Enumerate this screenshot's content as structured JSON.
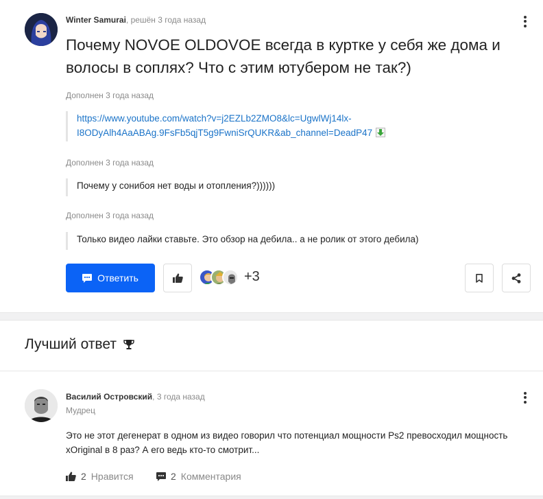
{
  "question": {
    "author": "Winter Samurai",
    "meta_suffix": ", решён 3 года назад",
    "title": "Почему NOVOE OLDOVOE всегда в куртке у себя же дома и волосы в соплях? Что с этим ютубером не так?)",
    "supplements": [
      {
        "label": "Дополнен 3 года назад",
        "link": "https://www.youtube.com/watch?v=j2EZLb2ZMO8&lc=UgwlWj14lx-I8ODyAlh4AaABAg.9FsFb5qjT5g9FwniSrQUKR&ab_channel=DeadP47"
      },
      {
        "label": "Дополнен 3 года назад",
        "text": "Почему у сонибоя нет воды и отопления?))))))"
      },
      {
        "label": "Дополнен 3 года назад",
        "text": "Только видео лайки ставьте. Это обзор на дебила.. а не ролик от этого дебила)"
      }
    ],
    "answer_button": "Ответить",
    "likers_more": "+3",
    "colors": {
      "accent": "#0b63f6",
      "link": "#1a73c8"
    }
  },
  "best_answer": {
    "heading": "Лучший ответ",
    "author": "Василий Островский",
    "meta_suffix": ", 3 года назад",
    "rank": "Мудрец",
    "text": "Это не этот дегенерат в одном из видео говорил что потенциал мощности Ps2 превосходил мощность xOriginal в 8 раз? А его ведь кто-то смотрит...",
    "likes_count": "2",
    "likes_label": "Нравится",
    "comments_count": "2",
    "comments_label": "Комментария"
  }
}
